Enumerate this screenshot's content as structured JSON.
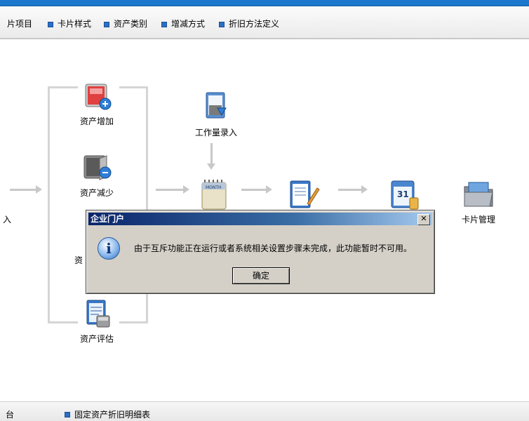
{
  "toolbar": {
    "items": [
      "片项目",
      "卡片样式",
      "资产类别",
      "增减方式",
      "折旧方法定义"
    ]
  },
  "flow": {
    "left_partial": "入",
    "asset_add": "资产增加",
    "asset_reduce": "资产减少",
    "asset_hidden": "资",
    "asset_evaluate": "资产评估",
    "workload_entry": "工作量录入",
    "month_label": "MONTH",
    "calendar_number": "31",
    "card_manage": "卡片管理"
  },
  "bottom": {
    "item1": "台",
    "item2": "固定资产折旧明细表"
  },
  "dialog": {
    "title": "企业门户",
    "close": "✕",
    "icon": "i",
    "message": "由于互斥功能正在运行或者系统相关设置步骤未完成，此功能暂时不可用。",
    "ok": "确定"
  },
  "colors": {
    "accent": "#1b78cc",
    "dialog_bg": "#d4d0c8",
    "title_bar": "#0a246a"
  }
}
